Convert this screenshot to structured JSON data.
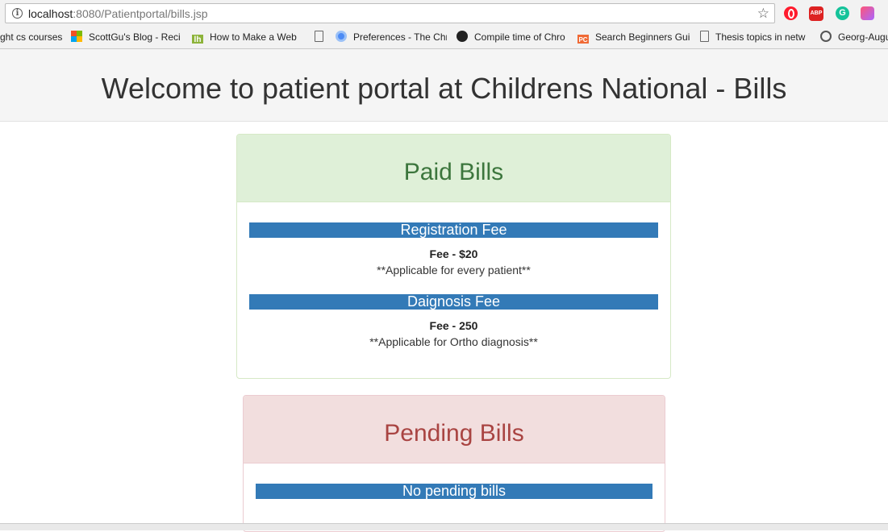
{
  "browser": {
    "url_host": "localhost",
    "url_path": ":8080/Patientportal/bills.jsp",
    "bookmarks": [
      {
        "label": "ght cs courses",
        "icon": "none"
      },
      {
        "label": "ScottGu's Blog - Reci",
        "icon": "microsoft-icon"
      },
      {
        "label": "How to Make a Web",
        "icon": "lh-icon"
      },
      {
        "label": "",
        "icon": "page-icon"
      },
      {
        "label": "Preferences - The Chr",
        "icon": "chrome-icon"
      },
      {
        "label": "Compile time of Chro",
        "icon": "github-icon"
      },
      {
        "label": "Search Beginners Gui",
        "icon": "pc-icon"
      },
      {
        "label": "Thesis topics in netw",
        "icon": "page-icon"
      },
      {
        "label": "Georg-Augu",
        "icon": "g-icon"
      }
    ],
    "extensions": {
      "abp": "ABP",
      "grammarly": "G"
    }
  },
  "header": {
    "title": "Welcome to patient portal at Childrens National - Bills"
  },
  "paid": {
    "title": "Paid Bills",
    "items": [
      {
        "name": "Registration Fee",
        "amount": "Fee - $20",
        "note": "**Applicable for every patient**"
      },
      {
        "name": "Daignosis Fee",
        "amount": "Fee - 250",
        "note": "**Applicable for Ortho diagnosis**"
      }
    ]
  },
  "pending": {
    "title": "Pending Bills",
    "message": "No pending bills"
  },
  "colors": {
    "primary_bar": "#337ab7",
    "success_bg": "#dff0d8",
    "success_text": "#3c763d",
    "danger_bg": "#f2dede",
    "danger_text": "#a94442"
  }
}
